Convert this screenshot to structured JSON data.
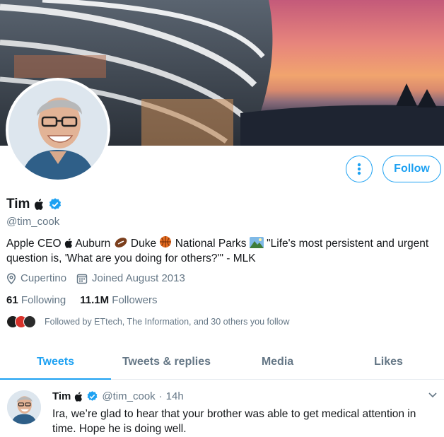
{
  "profile": {
    "name": "Tim",
    "handle": "@tim_cook",
    "bio": {
      "part1": "Apple CEO",
      "part2": "Auburn",
      "part3": "Duke",
      "part4": "National Parks",
      "part5": "\"Life's most persistent and urgent question is, 'What are you doing for others?'\" - MLK"
    },
    "location": "Cupertino",
    "joined": "Joined August 2013",
    "following_count": "61",
    "following_label": "Following",
    "followers_count": "11.1M",
    "followers_label": "Followers",
    "followed_by": "Followed by ETtech, The Information, and 30 others you follow"
  },
  "actions": {
    "follow_label": "Follow"
  },
  "tabs": [
    {
      "label": "Tweets",
      "active": true
    },
    {
      "label": "Tweets & replies",
      "active": false
    },
    {
      "label": "Media",
      "active": false
    },
    {
      "label": "Likes",
      "active": false
    }
  ],
  "tweet": {
    "name": "Tim",
    "handle": "@tim_cook",
    "time": "14h",
    "separator": "·",
    "text": "Ira, we’re glad to hear that your brother was able to get medical attention in time. Hope he is doing well."
  },
  "colors": {
    "accent": "#1da1f2",
    "muted": "#657786",
    "text": "#14171a"
  },
  "icons": [
    "apple-icon",
    "verified-icon",
    "more-icon",
    "location-icon",
    "calendar-icon",
    "football-icon",
    "basketball-icon",
    "national-park-icon",
    "chevron-down-icon"
  ]
}
